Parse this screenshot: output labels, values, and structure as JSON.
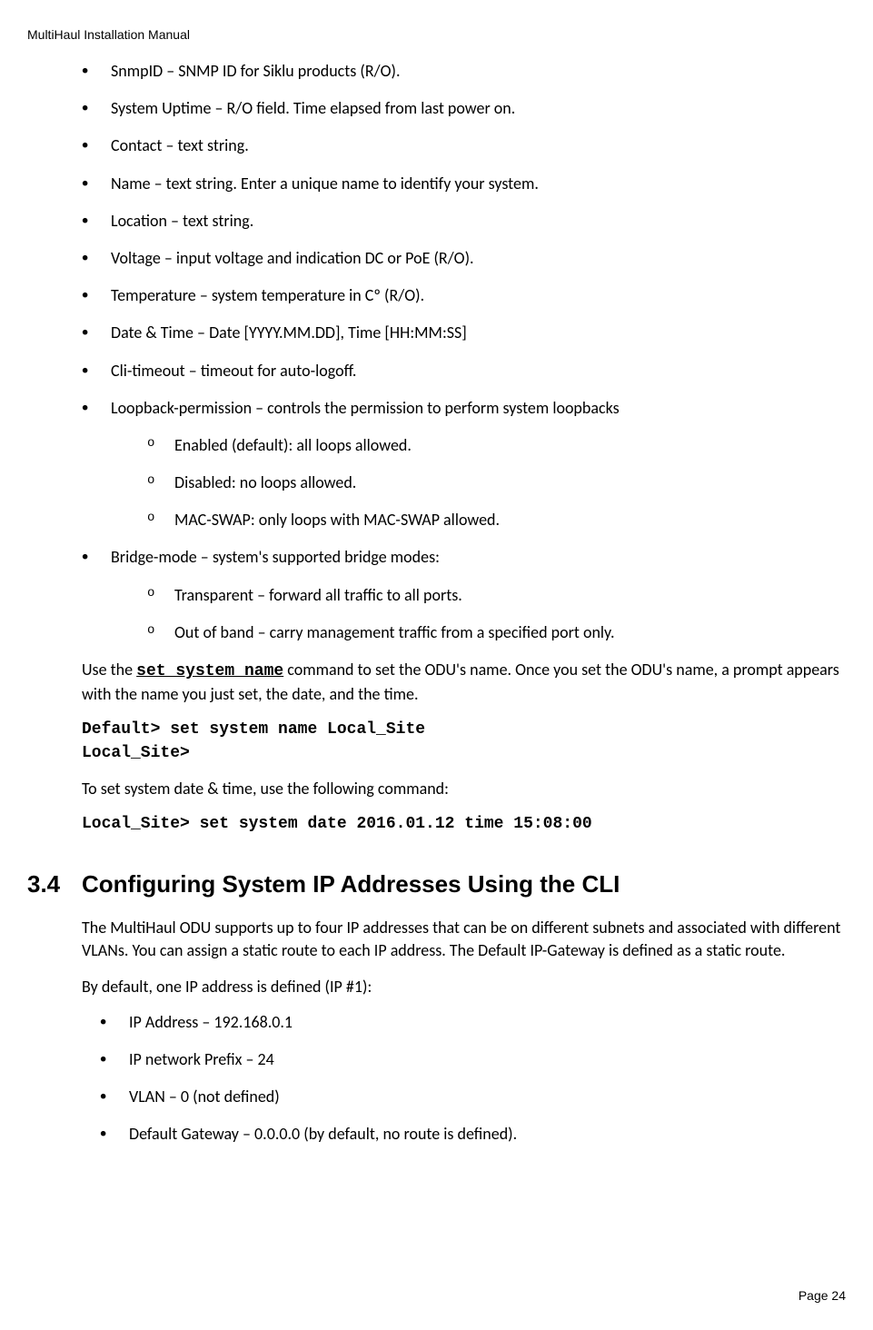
{
  "header": "MultiHaul Installation Manual",
  "bullets": [
    "SnmpID – SNMP ID for Siklu products (R/O).",
    "System Uptime – R/O field. Time elapsed from last power on.",
    "Contact – text string.",
    "Name – text string. Enter a unique name to identify your system.",
    "Location – text string.",
    "Voltage – input voltage and indication DC or PoE (R/O).",
    "Temperature – system temperature in Cº (R/O).",
    "Date & Time – Date [YYYY.MM.DD], Time [HH:MM:SS]",
    "Cli-timeout – timeout for auto-logoff.",
    "Loopback-permission – controls the permission to perform system loopbacks",
    "Bridge-mode – system's supported bridge modes:"
  ],
  "loopback_subs": [
    "Enabled (default): all loops allowed.",
    "Disabled: no loops allowed.",
    "MAC-SWAP: only loops with MAC-SWAP allowed."
  ],
  "bridge_subs": [
    "Transparent – forward all traffic to all ports.",
    "Out of band – carry management traffic from a specified port only."
  ],
  "para1_pre": "Use the ",
  "para1_code": "set system name",
  "para1_post": " command to set the ODU's name. Once you set the ODU's name, a prompt appears with the name you just set, the date, and the time.",
  "code1_line1": "Default> set system name Local_Site",
  "code1_line2": "Local_Site>",
  "para2": "To set system date & time, use the following command:",
  "code2": "Local_Site> set system date 2016.01.12 time 15:08:00",
  "section_number": "3.4",
  "section_title": "Configuring System IP Addresses Using the CLI",
  "para3": "The MultiHaul ODU supports up to four IP addresses that can be on different subnets and associated with different VLANs. You can assign a static route to each IP address. The Default IP-Gateway is defined as a static route.",
  "para4": "By default, one IP address is defined (IP #1):",
  "ip_bullets": [
    "IP Address – 192.168.0.1",
    "IP network Prefix – 24",
    "VLAN – 0 (not defined)",
    "Default Gateway – 0.0.0.0 (by default, no route is defined)."
  ],
  "footer": "Page 24"
}
